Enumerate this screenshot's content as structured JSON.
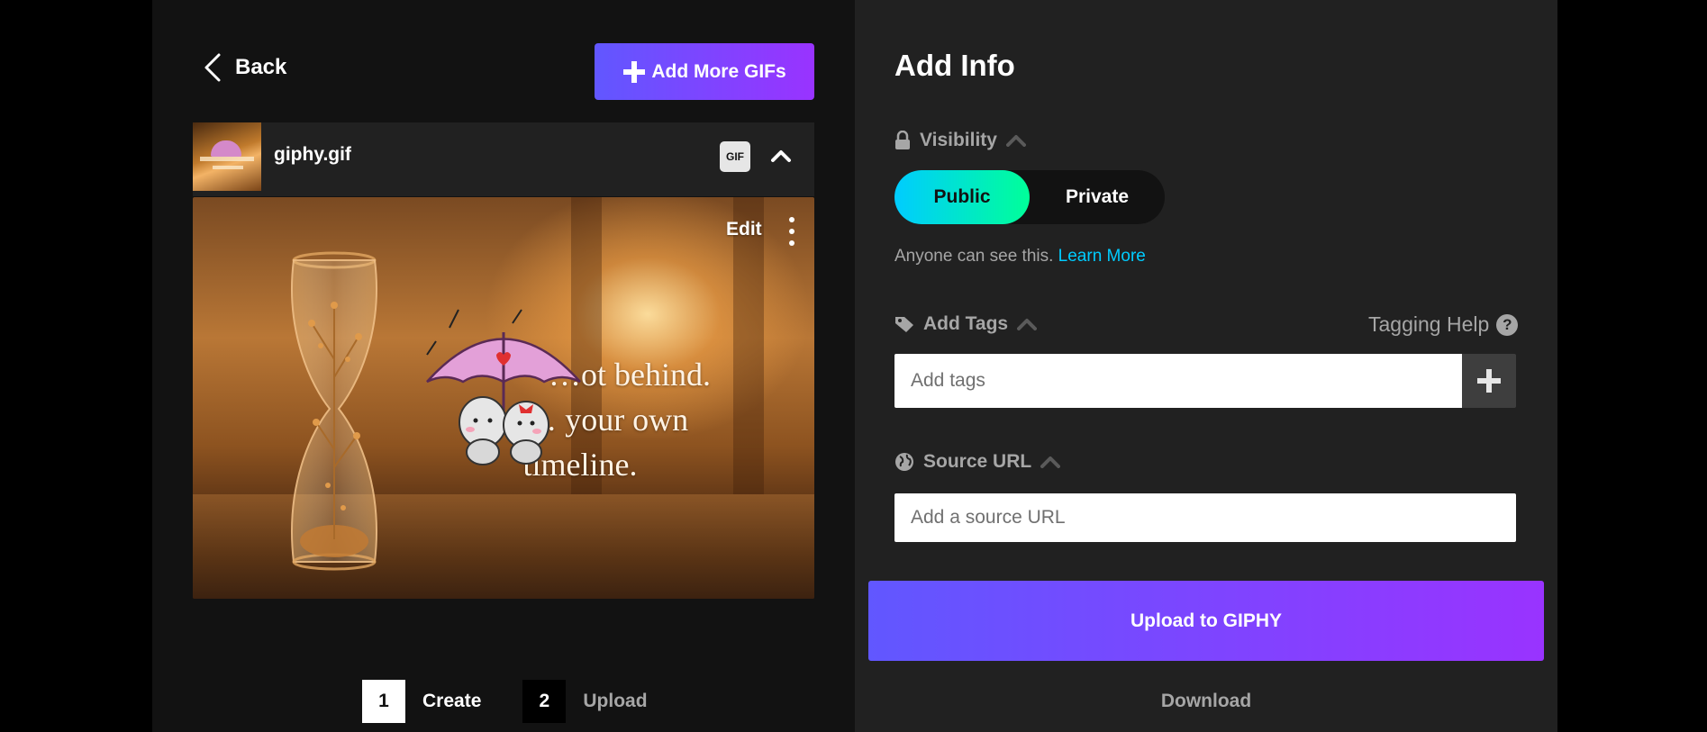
{
  "left_panel": {
    "back_label": "Back",
    "add_more_label": "Add More GIFs",
    "file": {
      "name": "giphy.gif",
      "badge": "GIF"
    },
    "preview": {
      "edit_label": "Edit",
      "quote_line1": "…ot behind.",
      "quote_line2": "You… your own",
      "quote_line3": "timeline."
    },
    "steps": [
      {
        "number": "1",
        "label": "Create",
        "active": true
      },
      {
        "number": "2",
        "label": "Upload",
        "active": false
      }
    ]
  },
  "right_panel": {
    "title": "Add Info",
    "visibility": {
      "label": "Visibility",
      "options": [
        "Public",
        "Private"
      ],
      "selected": "Public",
      "note": "Anyone can see this.",
      "learn_more": "Learn More"
    },
    "tags": {
      "label": "Add Tags",
      "help_label": "Tagging Help",
      "placeholder": "Add tags"
    },
    "source": {
      "label": "Source URL",
      "placeholder": "Add a source URL"
    },
    "upload_label": "Upload to GIPHY",
    "download_label": "Download"
  },
  "colors": {
    "accent_purple": "#6157ff",
    "accent_violet": "#9933ff",
    "toggle_cyan": "#00ccff",
    "toggle_green": "#00ff99",
    "link": "#00ccff"
  },
  "icons": [
    "chevron-left-icon",
    "plus-icon",
    "chevron-up-icon",
    "kebab-menu-icon",
    "lock-icon",
    "tag-icon",
    "globe-icon",
    "help-icon"
  ]
}
